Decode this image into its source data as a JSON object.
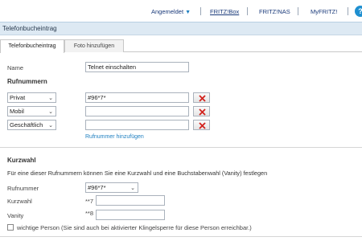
{
  "nav": {
    "logged_in": "Angemeldet",
    "fritzbox": "FRITZ!Box",
    "fritznas": "FRITZ!NAS",
    "myfritz": "MyFRITZ!",
    "help": "?"
  },
  "page_title": "Telefonbucheintrag",
  "tabs": [
    {
      "label": "Telefonbucheintrag"
    },
    {
      "label": "Foto hinzufügen"
    }
  ],
  "form": {
    "name_label": "Name",
    "name_value": "Telnet einschalten",
    "numbers_heading": "Rufnummern",
    "numbers": [
      {
        "type": "Privat",
        "value": "#96*7*"
      },
      {
        "type": "Mobil",
        "value": ""
      },
      {
        "type": "Geschäftlich",
        "value": ""
      }
    ],
    "add_number_link": "Rufnummer hinzufügen"
  },
  "kurzwahl": {
    "heading": "Kurzwahl",
    "description": "Für eine dieser Rufnummern können Sie eine Kurzwahl und eine Buchstabenwahl (Vanity) festlegen",
    "rufnummer_label": "Rufnummer",
    "rufnummer_value": "#96*7*",
    "kurzwahl_label": "Kurzwahl",
    "kurzwahl_prefix": "**7",
    "vanity_label": "Vanity",
    "vanity_prefix": "**8",
    "important_label": "wichtige Person (Sie sind auch bei aktivierter Klingelsperre für diese Person erreichbar.)",
    "important_checked": false
  }
}
